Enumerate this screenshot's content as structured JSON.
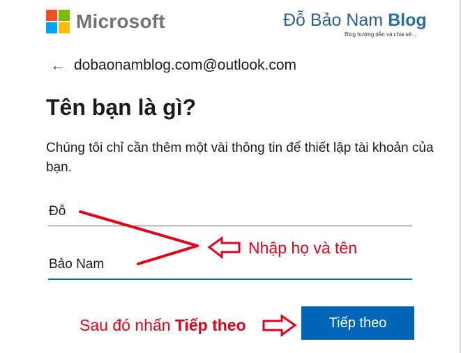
{
  "brand": {
    "microsoft": "Microsoft",
    "blog_name_regular": "Đỗ Bảo Nam ",
    "blog_name_bold": "Blog",
    "blog_tagline": "Blog hướng dẫn và chia sẻ..."
  },
  "header": {
    "back_arrow": "←",
    "email": "dobaonamblog.com@outlook.com"
  },
  "main": {
    "title": "Tên bạn là gì?",
    "description": "Chúng tôi chỉ cần thêm một vài thông tin để thiết lập tài khoản của bạn."
  },
  "form": {
    "last_name_value": "Đỗ",
    "first_name_value": "Bảo Nam"
  },
  "annotations": {
    "input_note": "Nhập họ và tên",
    "next_note_prefix": "Sau đó nhấn ",
    "next_note_bold": "Tiếp theo"
  },
  "actions": {
    "next_label": "Tiếp theo"
  },
  "colors": {
    "accent": "#0067b8",
    "annotation_red": "#e2001a"
  }
}
